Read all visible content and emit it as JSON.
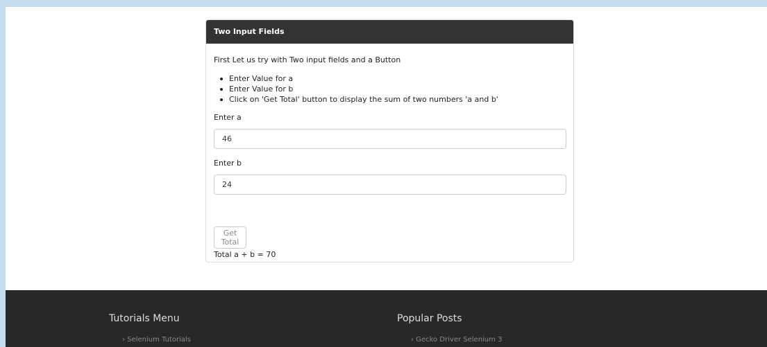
{
  "panel": {
    "title": "Two Input Fields",
    "intro": "First Let us try with Two input fields and a Button",
    "steps": [
      "Enter Value for a",
      "Enter Value for b",
      "Click on 'Get Total' button to display the sum of two numbers 'a and b'"
    ],
    "field_a": {
      "label": "Enter a",
      "value": "46"
    },
    "field_b": {
      "label": "Enter b",
      "value": "24"
    },
    "button_label": "Get Total",
    "result": "Total a + b = 70"
  },
  "footer": {
    "tutorials": {
      "heading": "Tutorials Menu",
      "link": "› Selenium Tutorials"
    },
    "popular": {
      "heading": "Popular Posts",
      "link": "› Gecko Driver Selenium 3"
    }
  },
  "colors": {
    "page_background": "#c4dcf0",
    "panel_heading": "#333333",
    "footer": "#282828"
  }
}
